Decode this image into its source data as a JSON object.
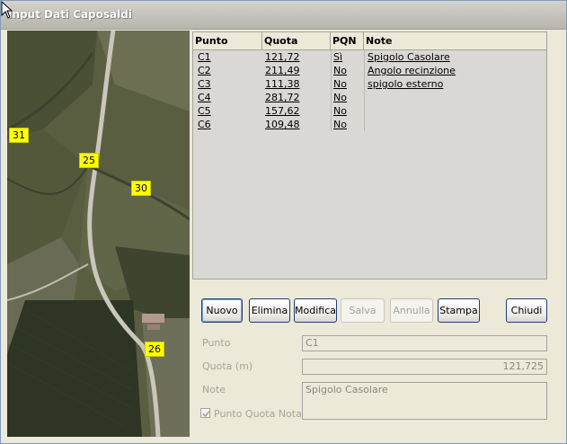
{
  "window": {
    "title": "Input Dati Caposaldi"
  },
  "map": {
    "markers": [
      {
        "label": "31"
      },
      {
        "label": "25"
      },
      {
        "label": "30"
      },
      {
        "label": "26"
      }
    ],
    "marker_color": "#ffff00"
  },
  "table": {
    "headers": [
      "Punto",
      "Quota",
      "PQN",
      "Note"
    ],
    "rows": [
      {
        "punto": "C1",
        "quota": "121,72",
        "pqn": "Sì",
        "note": "Spigolo Casolare"
      },
      {
        "punto": "C2",
        "quota": "211,49",
        "pqn": "No",
        "note": "Angolo recinzione"
      },
      {
        "punto": "C3",
        "quota": "111,38",
        "pqn": "No",
        "note": "spigolo esterno"
      },
      {
        "punto": "C4",
        "quota": "281,72",
        "pqn": "No",
        "note": ""
      },
      {
        "punto": "C5",
        "quota": "157,62",
        "pqn": "No",
        "note": ""
      },
      {
        "punto": "C6",
        "quota": "109,48",
        "pqn": "No",
        "note": ""
      }
    ]
  },
  "buttons": {
    "nuovo": "Nuovo",
    "elimina": "Elimina",
    "modifica": "Modifica",
    "salva": "Salva",
    "annulla": "Annulla",
    "stampa": "Stampa",
    "chiudi": "Chiudi"
  },
  "form": {
    "punto_label": "Punto",
    "punto_value": "C1",
    "quota_label": "Quota (m)",
    "quota_value": "121,725",
    "note_label": "Note",
    "note_value": "Spigolo Casolare",
    "pqn_label": "Punto Quota Nota",
    "pqn_checked": true
  },
  "colors": {
    "accent": "#1f3d7a",
    "disabled_text": "#a6a39c"
  }
}
